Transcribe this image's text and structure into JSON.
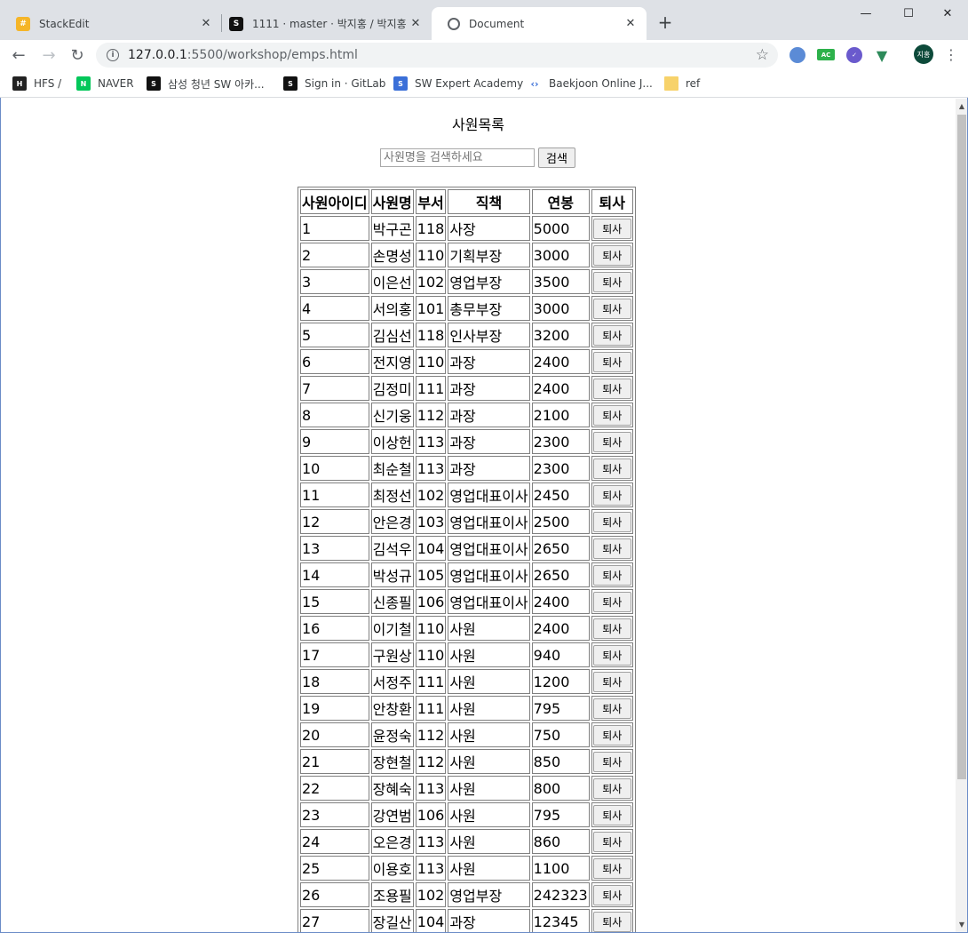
{
  "browser": {
    "tabs": [
      {
        "title": "StackEdit",
        "icon": "stackedit-icon",
        "active": false
      },
      {
        "title": "1111 · master · 박지홍 / 박지홍",
        "icon": "gitlab-icon",
        "active": false
      },
      {
        "title": "Document",
        "icon": "globe-icon",
        "active": true
      }
    ],
    "url_host": "127.0.0.1",
    "url_path": ":5500/workshop/emps.html",
    "bookmarks": [
      {
        "label": "HFS /",
        "icon": "hfs-icon"
      },
      {
        "label": "NAVER",
        "icon": "naver-icon"
      },
      {
        "label": "삼성 청년 SW 아카...",
        "icon": "samsung-icon"
      },
      {
        "label": "Sign in · GitLab",
        "icon": "gitlab-icon"
      },
      {
        "label": "SW Expert Academy",
        "icon": "swea-icon"
      },
      {
        "label": "Baekjoon Online J...",
        "icon": "code-icon"
      },
      {
        "label": "ref",
        "icon": "folder-icon"
      }
    ],
    "extensions": {
      "ac_label": "AC"
    },
    "profile_label": "지홍"
  },
  "page": {
    "title": "사원목록",
    "search": {
      "placeholder": "사원명을 검색하세요",
      "value": "",
      "button_label": "검색"
    },
    "table": {
      "headers": [
        "사원아이디",
        "사원명",
        "부서",
        "직책",
        "연봉",
        "퇴사"
      ],
      "retire_label": "퇴사",
      "rows": [
        [
          "1",
          "박구곤",
          "118",
          "사장",
          "5000"
        ],
        [
          "2",
          "손명성",
          "110",
          "기획부장",
          "3000"
        ],
        [
          "3",
          "이은선",
          "102",
          "영업부장",
          "3500"
        ],
        [
          "4",
          "서의홍",
          "101",
          "총무부장",
          "3000"
        ],
        [
          "5",
          "김심선",
          "118",
          "인사부장",
          "3200"
        ],
        [
          "6",
          "전지영",
          "110",
          "과장",
          "2400"
        ],
        [
          "7",
          "김정미",
          "111",
          "과장",
          "2400"
        ],
        [
          "8",
          "신기웅",
          "112",
          "과장",
          "2100"
        ],
        [
          "9",
          "이상헌",
          "113",
          "과장",
          "2300"
        ],
        [
          "10",
          "최순철",
          "113",
          "과장",
          "2300"
        ],
        [
          "11",
          "최정선",
          "102",
          "영업대표이사",
          "2450"
        ],
        [
          "12",
          "안은경",
          "103",
          "영업대표이사",
          "2500"
        ],
        [
          "13",
          "김석우",
          "104",
          "영업대표이사",
          "2650"
        ],
        [
          "14",
          "박성규",
          "105",
          "영업대표이사",
          "2650"
        ],
        [
          "15",
          "신종필",
          "106",
          "영업대표이사",
          "2400"
        ],
        [
          "16",
          "이기철",
          "110",
          "사원",
          "2400"
        ],
        [
          "17",
          "구원상",
          "110",
          "사원",
          "940"
        ],
        [
          "18",
          "서정주",
          "111",
          "사원",
          "1200"
        ],
        [
          "19",
          "안창환",
          "111",
          "사원",
          "795"
        ],
        [
          "20",
          "윤정숙",
          "112",
          "사원",
          "750"
        ],
        [
          "21",
          "장현철",
          "112",
          "사원",
          "850"
        ],
        [
          "22",
          "장혜숙",
          "113",
          "사원",
          "800"
        ],
        [
          "23",
          "강연범",
          "106",
          "사원",
          "795"
        ],
        [
          "24",
          "오은경",
          "113",
          "사원",
          "860"
        ],
        [
          "25",
          "이용호",
          "113",
          "사원",
          "1100"
        ],
        [
          "26",
          "조용필",
          "102",
          "영업부장",
          "242323"
        ],
        [
          "27",
          "장길산",
          "104",
          "과장",
          "12345"
        ]
      ]
    }
  }
}
